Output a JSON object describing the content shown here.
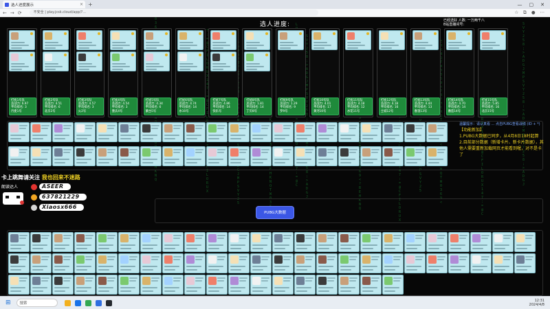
{
  "browser": {
    "tab_title": "选人进度展示",
    "url": "不安全 | play.jcsk.cloud/app/?...",
    "nav_back": "←",
    "nav_forward": "→",
    "nav_reload": "⟳"
  },
  "page": {
    "stage_title": "选人进度:",
    "notice_line1": "已经选好 人数: 一万两千八",
    "notice_line2": "B站直播间号:"
  },
  "teams": [
    {
      "name": "打扰1号队",
      "sum": "6.97",
      "avg": "4.44",
      "rank": "3",
      "idx": "丹麦1号"
    },
    {
      "name": "打扰2号队",
      "sum": "4.51",
      "avg": "5.02",
      "rank": "6",
      "idx": "北京2号"
    },
    {
      "name": "打扰3号队",
      "sum": "4.57",
      "avg": "6.50",
      "rank": "3",
      "idx": "火2号"
    },
    {
      "name": "打扰4号队",
      "sum": "4.54",
      "avg": "5.02",
      "rank": "3",
      "idx": "重庆4号"
    },
    {
      "name": "打扰5号队",
      "sum": "4.34",
      "avg": "4.65",
      "rank": "6",
      "idx": "蒙古5号"
    },
    {
      "name": "打扰6号队",
      "sum": "4.74",
      "avg": "5.18",
      "rank": "14",
      "idx": "水10号"
    },
    {
      "name": "打扰7号队",
      "sum": "4.86",
      "avg": "4.88",
      "rank": "14",
      "idx": "快乐号"
    },
    {
      "name": "打扰8号队",
      "sum": "1.81",
      "avg": "4.44",
      "rank": "14",
      "idx": "丁贝8号"
    },
    {
      "name": "打扰9号队",
      "sum": "1.29",
      "avg": "4.12",
      "rank": "9",
      "idx": "罗9号"
    },
    {
      "name": "打扰10号队",
      "sum": "4.01",
      "avg": "4.55",
      "rank": "17",
      "idx": "黄河10号"
    },
    {
      "name": "打扰11号队",
      "sum": "4.18",
      "avg": "4.78",
      "rank": "12",
      "idx": "水花11号"
    },
    {
      "name": "打扰12号队",
      "sum": "4.18",
      "avg": "4.92",
      "rank": "16",
      "idx": "士城12号"
    },
    {
      "name": "打扰13号队",
      "sum": "4.44",
      "avg": "5.02",
      "rank": "13",
      "idx": "春温13号"
    },
    {
      "name": "打扰14号队",
      "sum": "4.70",
      "avg": "5.14",
      "rank": "14",
      "idx": "番茄14号"
    },
    {
      "name": "打扰15号队",
      "sum": "5.85",
      "avg": "5.62",
      "rank": "16",
      "idx": "北京15号"
    }
  ],
  "team_labels": {
    "name_prefix": "队伍",
    "sum": "总战力:",
    "avg": "平均排名:",
    "idx": ""
  },
  "info": {
    "header": "温馨提示：请认真看 ... 点击PUBG查看战绩 (ID + *)",
    "title": "【功能新加】",
    "line1": "1.PUBG大数据已同步，从4月8日18时起算",
    "line2": "2.目前部分数据（新增卡片、新卡片数据），其他人需要重新加载网页才能看到喔，对不是卡了"
  },
  "promo": {
    "headline_white": "卡上跳舞请关注",
    "headline_yellow": "我也回来不迷路",
    "logo_text": "朗读达人",
    "contacts": [
      {
        "icon": "weibo-icon",
        "value": "ASEER"
      },
      {
        "icon": "qq-icon",
        "value": "637821229"
      },
      {
        "icon": "wechat-icon",
        "value": "Xiaosx666"
      }
    ]
  },
  "pubg_button": "PUBG大数据",
  "taskbar": {
    "search": "搜索",
    "time": "12:31",
    "date": "2024/4/8"
  },
  "colors": {
    "card_bg": "#bfe8ef",
    "team_bg": "#1f8a3b",
    "accent_yellow": "#f0d224",
    "button_blue": "#3b57e6"
  }
}
